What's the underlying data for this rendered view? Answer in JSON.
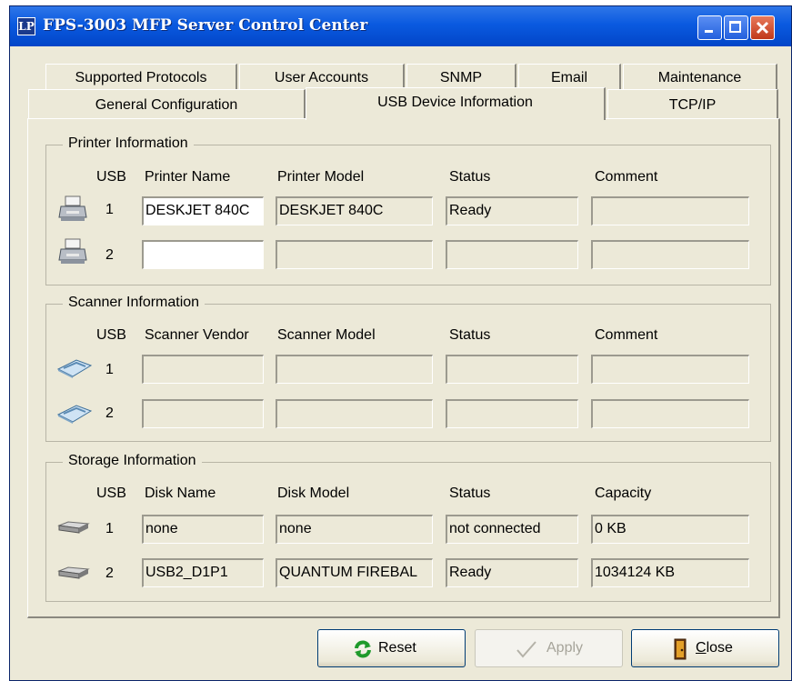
{
  "window": {
    "title": "FPS-3003 MFP Server Control Center",
    "app_icon_glyph": "LP"
  },
  "tabs_back": [
    "Supported Protocols",
    "User Accounts",
    "SNMP",
    "Email",
    "Maintenance"
  ],
  "tabs_front": [
    "General Configuration",
    "USB Device Information",
    "TCP/IP"
  ],
  "active_tab": "USB Device Information",
  "printer": {
    "title": "Printer Information",
    "headers": [
      "USB",
      "Printer Name",
      "Printer Model",
      "Status",
      "Comment"
    ],
    "rows": [
      {
        "usb": "1",
        "name": "DESKJET 840C",
        "model": "DESKJET 840C",
        "status": "Ready",
        "comment": ""
      },
      {
        "usb": "2",
        "name": "",
        "model": "",
        "status": "",
        "comment": ""
      }
    ]
  },
  "scanner": {
    "title": "Scanner Information",
    "headers": [
      "USB",
      "Scanner Vendor",
      "Scanner Model",
      "Status",
      "Comment"
    ],
    "rows": [
      {
        "usb": "1",
        "vendor": "",
        "model": "",
        "status": "",
        "comment": ""
      },
      {
        "usb": "2",
        "vendor": "",
        "model": "",
        "status": "",
        "comment": ""
      }
    ]
  },
  "storage": {
    "title": "Storage Information",
    "headers": [
      "USB",
      "Disk Name",
      "Disk Model",
      "Status",
      "Capacity"
    ],
    "rows": [
      {
        "usb": "1",
        "name": "none",
        "model": "none",
        "status": "not connected",
        "capacity": "0 KB"
      },
      {
        "usb": "2",
        "name": "USB2_D1P1",
        "model": "QUANTUM FIREBAL",
        "status": "Ready",
        "capacity": "1034124 KB"
      }
    ]
  },
  "buttons": {
    "reset": "Reset",
    "apply": "Apply",
    "close_prefix": "C",
    "close_rest": "lose"
  },
  "icons": {
    "printer": "printer-icon",
    "scanner": "scanner-icon",
    "disk": "disk-drive-icon"
  },
  "colors": {
    "titlebar": "#0a5ae0",
    "face": "#ece9d8",
    "close_red": "#c0391b"
  }
}
